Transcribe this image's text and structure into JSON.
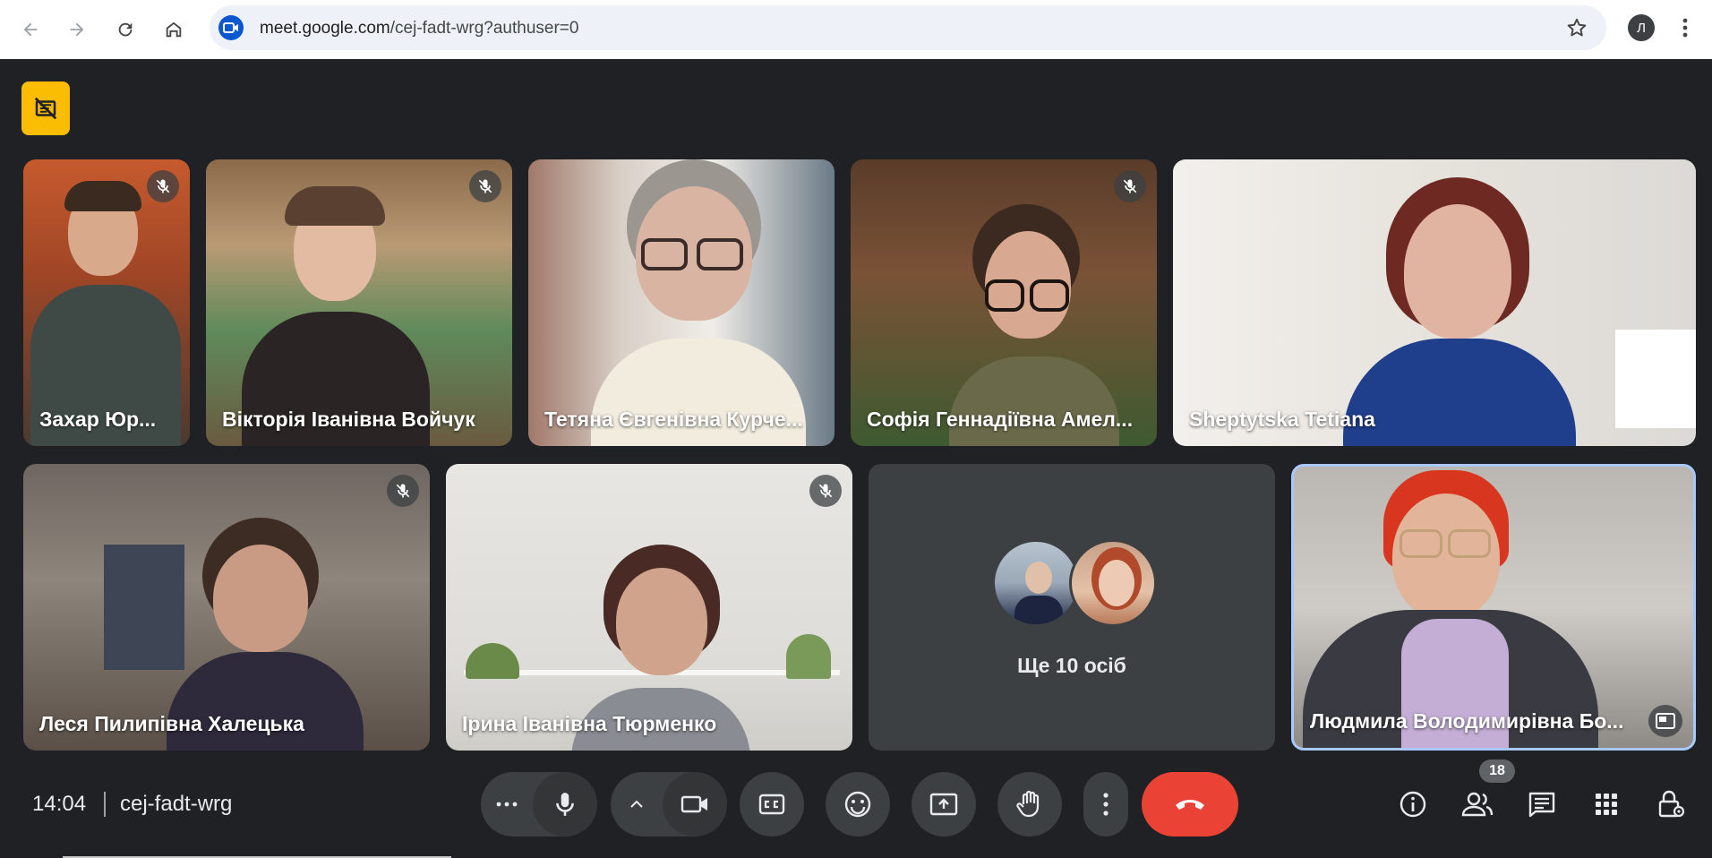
{
  "browser": {
    "url_host": "meet.google.com",
    "url_path": "/cej-fadt-wrg?authuser=0",
    "profile_initial": "Л"
  },
  "participants": [
    {
      "name": "Захар Юр...",
      "muted": true
    },
    {
      "name": "Вікторія Іванівна Войчук",
      "muted": true
    },
    {
      "name": "Тетяна Євгенівна Курче...",
      "muted": false
    },
    {
      "name": "Софія Геннадіївна Амел...",
      "muted": true
    },
    {
      "name": "Sheptytska Tetiana",
      "muted": false
    },
    {
      "name": "Леся Пилипівна Халецька",
      "muted": true
    },
    {
      "name": "Ірина Іванівна Тюрменко",
      "muted": true
    },
    {
      "name": "Людмила Володимирівна Бо...",
      "muted": false
    }
  ],
  "more_participants": {
    "label": "Ще 10 осіб"
  },
  "bottom_bar": {
    "time": "14:04",
    "meeting_code": "cej-fadt-wrg",
    "people_count": "18"
  },
  "colors": {
    "background": "#202124",
    "tile_gray": "#3c4043",
    "end_call": "#ea4335",
    "badge_yellow": "#fbbc04",
    "active_speaker_border": "#a8c7fa"
  },
  "icons": [
    "back-icon",
    "forward-icon",
    "reload-icon",
    "home-icon",
    "meet-icon",
    "star-icon",
    "menu-icon",
    "visibility-off-icon",
    "mic-off-icon",
    "more-icon",
    "mic-icon",
    "chevron-up-icon",
    "camera-icon",
    "captions-icon",
    "emoji-icon",
    "present-icon",
    "raise-hand-icon",
    "end-call-icon",
    "info-icon",
    "people-icon",
    "chat-icon",
    "activities-icon",
    "host-controls-icon",
    "pip-icon"
  ]
}
